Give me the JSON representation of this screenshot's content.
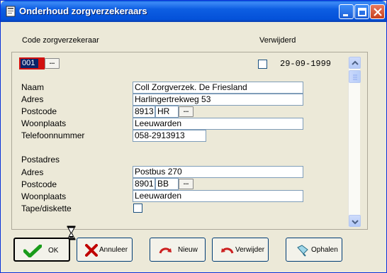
{
  "window": {
    "title": "Onderhoud zorgverzekeraars"
  },
  "header": {
    "code_label": "Code zorgverzekeraar",
    "deleted_label": "Verwijderd"
  },
  "record": {
    "code": "001",
    "lookup_button": "...",
    "deleted_date": "29-09-1999",
    "deleted_checked": false
  },
  "fields": {
    "naam_label": "Naam",
    "naam_value": "Coll Zorgverzek. De Friesland",
    "adres_label": "Adres",
    "adres_value": "Harlingertrekweg 53",
    "postcode_label": "Postcode",
    "postcode_num": "8913",
    "postcode_letters": "HR",
    "woonplaats_label": "Woonplaats",
    "woonplaats_value": "Leeuwarden",
    "telefoon_label": "Telefoonnummer",
    "telefoon_value": "058-2913913"
  },
  "postadres": {
    "section_label": "Postadres",
    "adres_label": "Adres",
    "adres_value": "Postbus 270",
    "postcode_label": "Postcode",
    "postcode_num": "8901",
    "postcode_letters": "BB",
    "woonplaats_label": "Woonplaats",
    "woonplaats_value": "Leeuwarden",
    "tape_label": "Tape/diskette",
    "tape_checked": false
  },
  "buttons": {
    "ok": "OK",
    "annuleer": "Annuleer",
    "nieuw": "Nieuw",
    "verwijder": "Verwijder",
    "ophalen": "Ophalen"
  },
  "colors": {
    "title_bar": "#0a5bd8",
    "code_border": "#d11010",
    "code_bg": "#0a246a",
    "ok_check": "#1a9c1a",
    "cancel_x": "#c00000",
    "arrow_red": "#cc2020"
  }
}
